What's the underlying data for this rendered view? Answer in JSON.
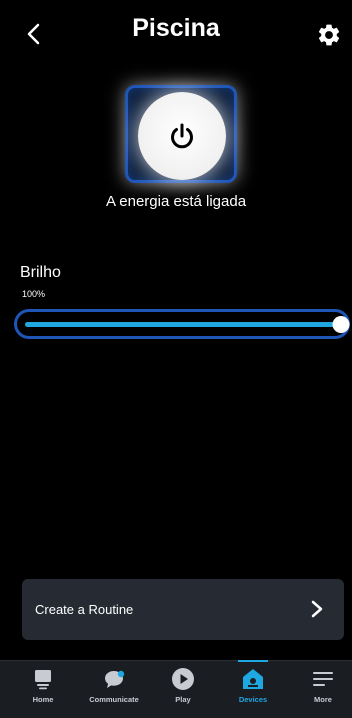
{
  "header": {
    "title": "Piscina",
    "back_icon": "chevron-left-icon",
    "settings_icon": "gear-icon"
  },
  "power": {
    "icon": "power-icon",
    "status": "A energia está ligada",
    "on": true
  },
  "brightness": {
    "label": "Brilho",
    "value_text": "100%",
    "value": 1.0
  },
  "routine": {
    "label": "Create a Routine",
    "icon": "chevron-right-icon"
  },
  "tabs": [
    {
      "label": "Home",
      "icon": "home-icon"
    },
    {
      "label": "Communicate",
      "icon": "chat-bubble-icon"
    },
    {
      "label": "Play",
      "icon": "play-icon"
    },
    {
      "label": "Devices",
      "icon": "devices-icon",
      "active": true
    },
    {
      "label": "More",
      "icon": "menu-icon"
    }
  ],
  "colors": {
    "accent": "#1ea7e1",
    "frame": "#1e56b8",
    "background": "#000000",
    "card": "#262b33",
    "tabbar": "#1a1d22"
  }
}
